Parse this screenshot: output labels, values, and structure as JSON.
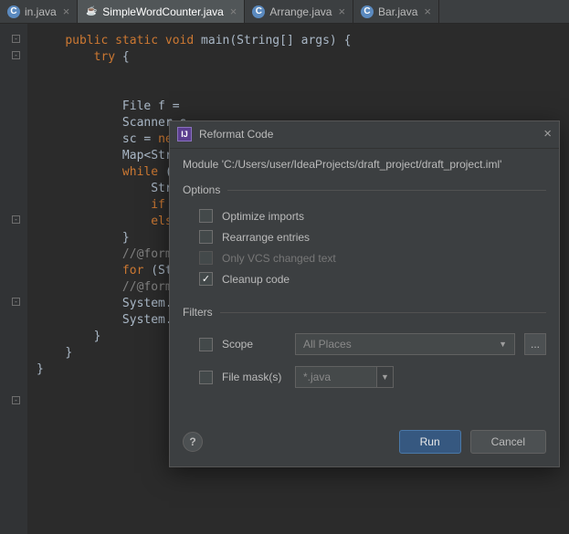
{
  "tabs": [
    {
      "label": "in.java",
      "active": false,
      "iconType": "class"
    },
    {
      "label": "SimpleWordCounter.java",
      "active": true,
      "iconType": "java"
    },
    {
      "label": "Arrange.java",
      "active": false,
      "iconType": "class"
    },
    {
      "label": "Bar.java",
      "active": false,
      "iconType": "class"
    }
  ],
  "code": {
    "l1a": "public",
    "l1b": "static",
    "l1c": "void",
    "l1d": " main(String[] args) {",
    "l2a": "try",
    "l2b": " {",
    "l3": "File f = ",
    "l4": "Scanner s",
    "l5a": "sc = ",
    "l5b": "new",
    "l6": "Map<Strin",
    "l7a": "while",
    "l7b": " (s",
    "l8": "Strin",
    "l9a": "if",
    "l9b": " (",
    "l10a": "else",
    "l11": "}",
    "l12": "//@format",
    "l13a": "for",
    "l13b": " (Stri",
    "l14": "//@format",
    "l15": "System.ou",
    "l16": "System.ou",
    "l17": "}",
    "l18": "}",
    "l19": "}"
  },
  "dialog": {
    "title": "Reformat Code",
    "module": "Module 'C:/Users/user/IdeaProjects/draft_project/draft_project.iml'",
    "options_label": "Options",
    "opt_optimize": "Optimize imports",
    "opt_rearrange": "Rearrange entries",
    "opt_vcs": "Only VCS changed text",
    "opt_cleanup": "Cleanup code",
    "filters_label": "Filters",
    "scope_label": "Scope",
    "scope_value": "All Places",
    "mask_label": "File mask(s)",
    "mask_value": "*.java",
    "ellipsis": "...",
    "help": "?",
    "run": "Run",
    "cancel": "Cancel"
  }
}
